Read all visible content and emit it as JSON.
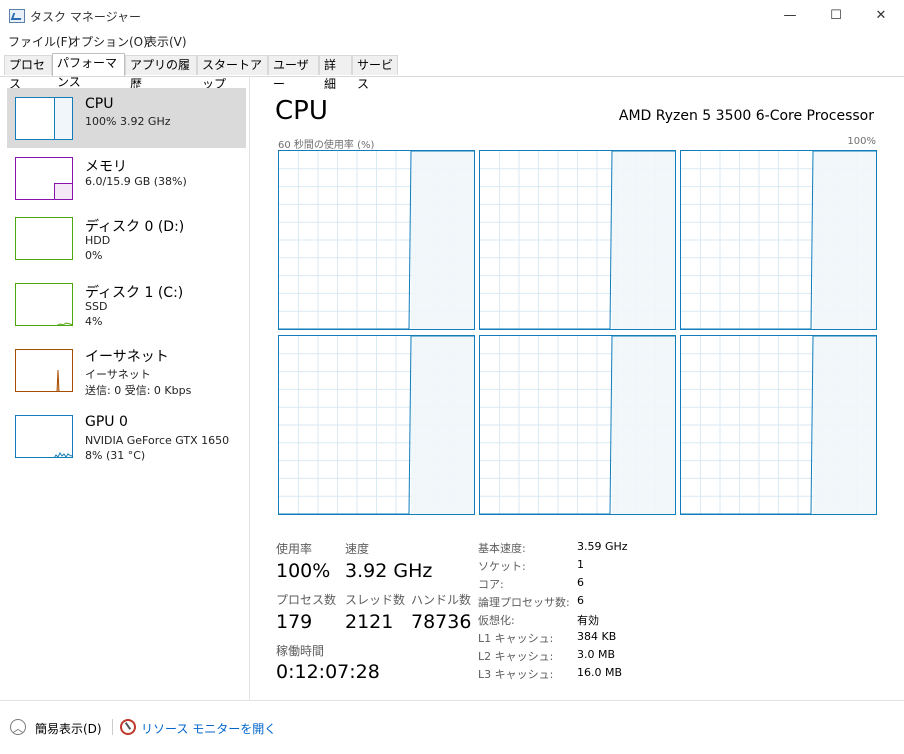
{
  "window": {
    "title": "タスク マネージャー",
    "minimize": "—",
    "maximize": "☐",
    "close": "✕"
  },
  "menu": [
    "ファイル(F)",
    "オプション(O)",
    "表示(V)"
  ],
  "tabs": [
    "プロセス",
    "パフォーマンス",
    "アプリの履歴",
    "スタートアップ",
    "ユーザー",
    "詳細",
    "サービス"
  ],
  "active_tab": "パフォーマンス",
  "sidebar": {
    "items": [
      {
        "title": "CPU",
        "line1": "100%  3.92 GHz",
        "line2": "",
        "color": "#117dbb",
        "usage": 1.0
      },
      {
        "title": "メモリ",
        "line1": "6.0/15.9 GB (38%)",
        "line2": "",
        "color": "#8b12ae",
        "usage": 0.38
      },
      {
        "title": "ディスク 0 (D:)",
        "line1": "HDD",
        "line2": "0%",
        "color": "#4da60c",
        "usage": 0.0
      },
      {
        "title": "ディスク 1 (C:)",
        "line1": "SSD",
        "line2": "4%",
        "color": "#4da60c",
        "usage": 0.04
      },
      {
        "title": "イーサネット",
        "line1": "イーサネット",
        "line2": "送信: 0  受信: 0 Kbps",
        "color": "#a74f01",
        "usage": 0.0
      },
      {
        "title": "GPU 0",
        "line1": "NVIDIA GeForce GTX 1650",
        "line2": "8% (31 °C)",
        "color": "#117dbb",
        "usage": 0.08
      }
    ]
  },
  "main": {
    "heading": "CPU",
    "model": "AMD Ryzen 5 3500 6-Core Processor",
    "graph_label": "60 秒間の使用率 (%)",
    "graph_max": "100%",
    "core_count": 6,
    "core_usage_percent": 100,
    "graph_color": "#117dbb"
  },
  "stats": {
    "usage_label": "使用率",
    "usage_value": "100%",
    "speed_label": "速度",
    "speed_value": "3.92 GHz",
    "process_label": "プロセス数",
    "process_value": "179",
    "thread_label": "スレッド数",
    "thread_value": "2121",
    "handle_label": "ハンドル数",
    "handle_value": "78736",
    "uptime_label": "稼働時間",
    "uptime_value": "0:12:07:28"
  },
  "specs": [
    {
      "label": "基本速度:",
      "value": "3.59 GHz"
    },
    {
      "label": "ソケット:",
      "value": "1"
    },
    {
      "label": "コア:",
      "value": "6"
    },
    {
      "label": "論理プロセッサ数:",
      "value": "6"
    },
    {
      "label": "仮想化:",
      "value": "有効"
    },
    {
      "label": "L1 キャッシュ:",
      "value": "384 KB"
    },
    {
      "label": "L2 キャッシュ:",
      "value": "3.0 MB"
    },
    {
      "label": "L3 キャッシュ:",
      "value": "16.0 MB"
    }
  ],
  "footer": {
    "collapse_label": "簡易表示(D)",
    "resmon_label": "リソース モニターを開く"
  }
}
